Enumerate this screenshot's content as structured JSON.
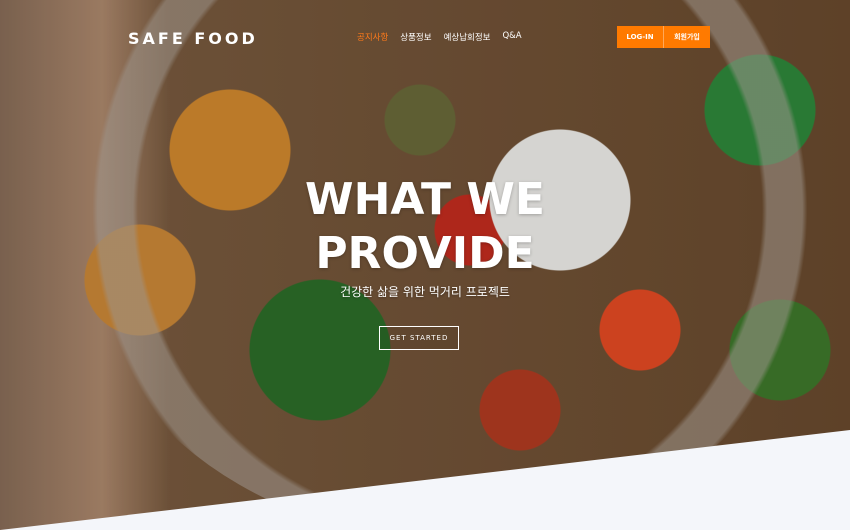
{
  "header": {
    "brand": "SAFE FOOD",
    "nav": [
      "공지사항",
      "상품정보",
      "예상납회정보",
      "Q&A"
    ],
    "login_label": "LOG-IN",
    "signup_label": "회원가입"
  },
  "hero": {
    "title_line1": "WHAT WE",
    "title_line2": "PROVIDE",
    "subtitle": "건강한 삶을 위한 먹거리 프로젝트",
    "cta_label": "GET STARTED"
  },
  "colors": {
    "accent": "#ff7a00",
    "section_bg": "#f4f6fa"
  }
}
